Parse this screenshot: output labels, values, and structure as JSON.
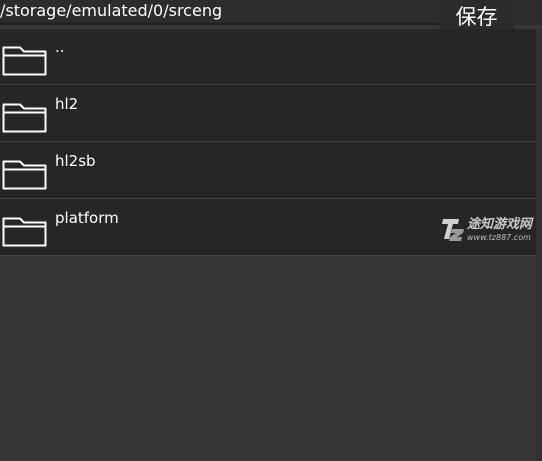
{
  "header": {
    "path": "/storage/emulated/0/srceng",
    "save_label": "保存"
  },
  "file_list": {
    "items": [
      {
        "label": "..",
        "icon": "folder-icon"
      },
      {
        "label": "hl2",
        "icon": "folder-icon"
      },
      {
        "label": "hl2sb",
        "icon": "folder-icon"
      },
      {
        "label": "platform",
        "icon": "folder-icon"
      }
    ]
  },
  "watermark": {
    "title": "途知游戏网",
    "url": "www.tz887.com",
    "logo_text": "TZ"
  },
  "colors": {
    "background": "#373737",
    "list_background": "#262725",
    "row_divider": "#424242",
    "text": "#ffffff"
  }
}
